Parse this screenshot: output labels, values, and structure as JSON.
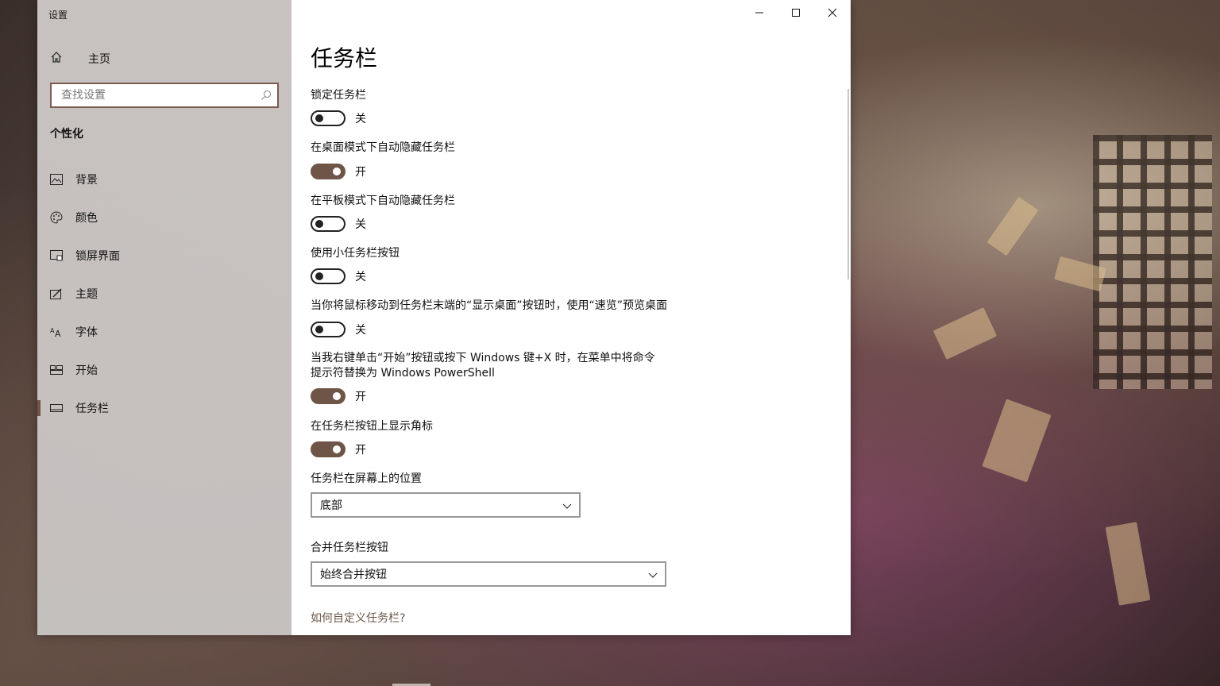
{
  "window": {
    "app_title": "设置",
    "controls": {
      "minimize": "minimize-icon",
      "maximize": "maximize-icon",
      "close": "close-icon"
    }
  },
  "sidebar": {
    "home_label": "主页",
    "search_placeholder": "查找设置",
    "section_title": "个性化",
    "items": [
      {
        "label": "背景",
        "icon": "picture-icon"
      },
      {
        "label": "颜色",
        "icon": "palette-icon"
      },
      {
        "label": "锁屏界面",
        "icon": "lock-screen-icon"
      },
      {
        "label": "主题",
        "icon": "theme-icon"
      },
      {
        "label": "字体",
        "icon": "font-icon"
      },
      {
        "label": "开始",
        "icon": "start-icon"
      },
      {
        "label": "任务栏",
        "icon": "taskbar-icon",
        "active": true
      }
    ]
  },
  "main": {
    "title": "任务栏",
    "settings": [
      {
        "label": "锁定任务栏",
        "state": "关"
      },
      {
        "label": "在桌面模式下自动隐藏任务栏",
        "state": "开"
      },
      {
        "label": "在平板模式下自动隐藏任务栏",
        "state": "关"
      },
      {
        "label": "使用小任务栏按钮",
        "state": "关"
      },
      {
        "label": "当你将鼠标移动到任务栏末端的“显示桌面”按钮时，使用“速览”预览桌面",
        "state": "关"
      },
      {
        "label": "当我右键单击“开始”按钮或按下 Windows 键+X 时，在菜单中将命令提示符替换为 Windows PowerShell",
        "state": "开"
      },
      {
        "label": "在任务栏按钮上显示角标",
        "state": "开"
      }
    ],
    "position": {
      "label": "任务栏在屏幕上的位置",
      "value": "底部"
    },
    "combine": {
      "label": "合并任务栏按钮",
      "value": "始终合并按钮"
    },
    "help_link": "如何自定义任务栏?"
  },
  "colors": {
    "accent": "#6e5548",
    "toggle_off_border": "#222222"
  }
}
